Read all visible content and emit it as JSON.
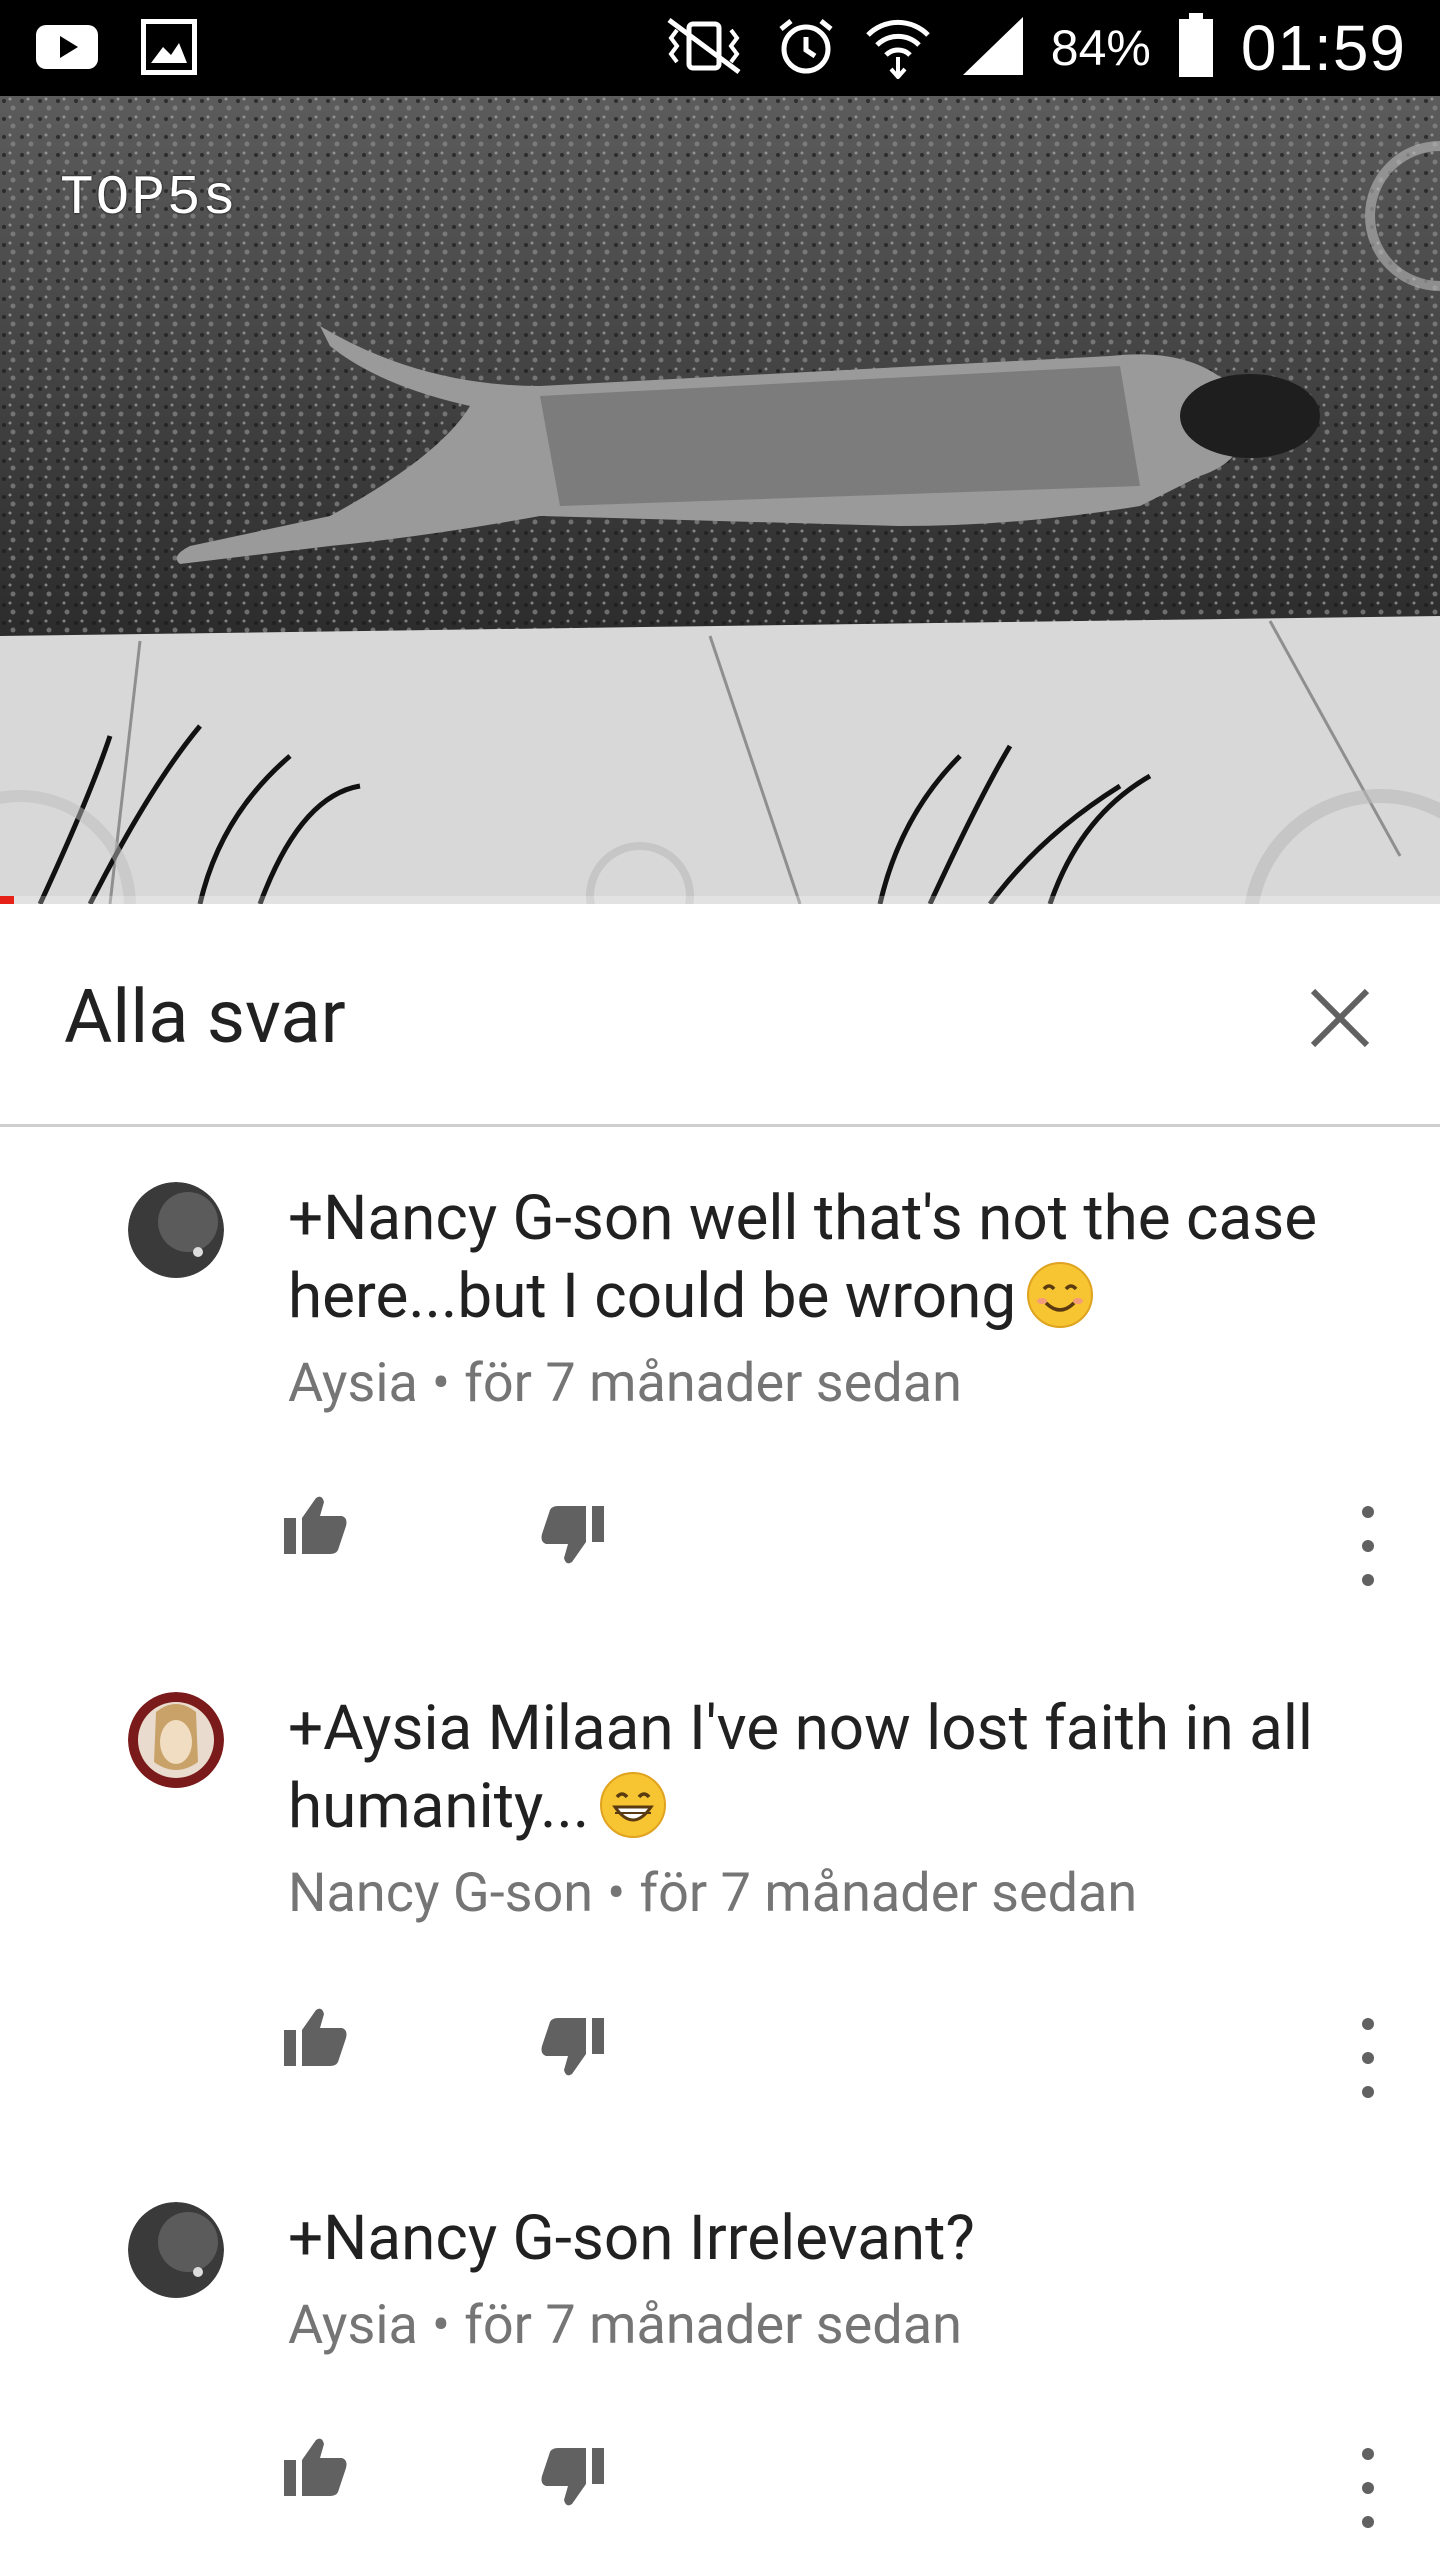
{
  "status_bar": {
    "battery": "84%",
    "time": "01:59",
    "icons": [
      "youtube-icon",
      "gallery-icon",
      "vibrate-mute-icon",
      "alarm-icon",
      "wifi-icon",
      "signal-icon",
      "battery-icon"
    ]
  },
  "video": {
    "watermark": "TOP5s",
    "progress_fraction": 0.01,
    "progress_color": "#e62117"
  },
  "panel": {
    "title": "Alla svar",
    "close_icon": "close-icon"
  },
  "replies": [
    {
      "text": "+Nancy G-son well that's not the case here...but I could be wrong",
      "emoji": "smiling-face-emoji",
      "author": "Aysia",
      "separator": "•",
      "time": "för 7 månader sedan"
    },
    {
      "text": "+Aysia Milaan I've now lost faith in all humanity...",
      "emoji": "grinning-face-emoji",
      "author": "Nancy G-son",
      "separator": "•",
      "time": "för 7 månader sedan"
    },
    {
      "text": "+Nancy G-son Irrelevant?",
      "emoji": "",
      "author": "Aysia",
      "separator": "•",
      "time": "för 7 månader sedan"
    }
  ],
  "colors": {
    "text_primary": "#212121",
    "text_secondary": "#757575",
    "icon": "#616161",
    "divider": "#cfcfcf"
  }
}
